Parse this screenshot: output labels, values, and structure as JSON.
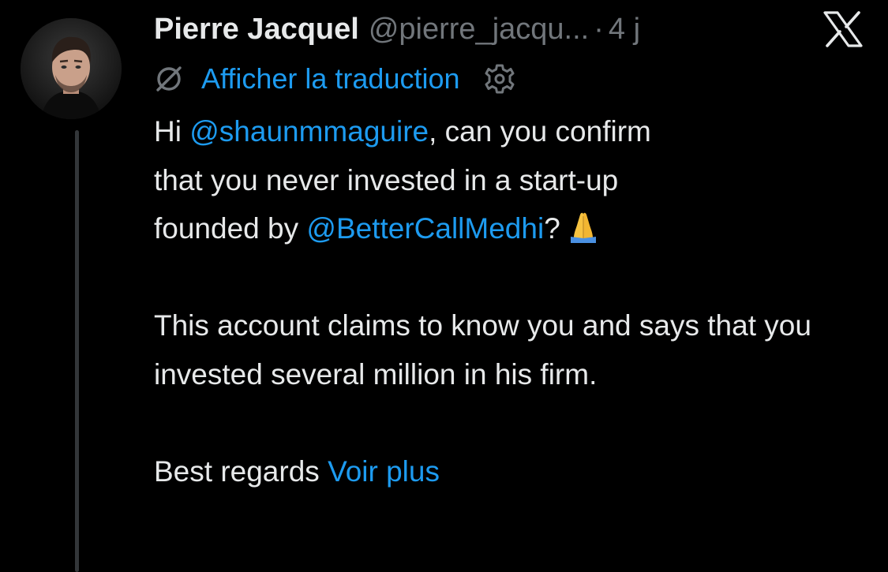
{
  "tweet": {
    "author": {
      "display_name": "Pierre Jacquel",
      "handle": "@pierre_jacqu...",
      "separator": "·",
      "time": "4 j",
      "avatar": "avatar"
    },
    "translate": {
      "icon": "translate-icon",
      "label": "Afficher la traduction",
      "settings_icon": "gear-icon"
    },
    "body": {
      "line1_prefix": "Hi ",
      "mention1": "@shaunmmaguire",
      "line1_suffix": ", can you confirm",
      "line2": "that you never invested in a start-up",
      "line3_prefix": "founded by ",
      "mention2": "@BetterCallMedhi",
      "line3_suffix": "?",
      "emoji": "folded-hands",
      "paragraph2": "This account claims to know you and says that you invested several million in his firm.",
      "closing": "Best regards",
      "show_more": "Voir plus"
    }
  },
  "brand": {
    "logo": "x-logo"
  },
  "colors": {
    "background": "#000000",
    "text": "#e7e9ea",
    "muted": "#71767b",
    "accent": "#1d9bf0",
    "thread_line": "#333639"
  }
}
